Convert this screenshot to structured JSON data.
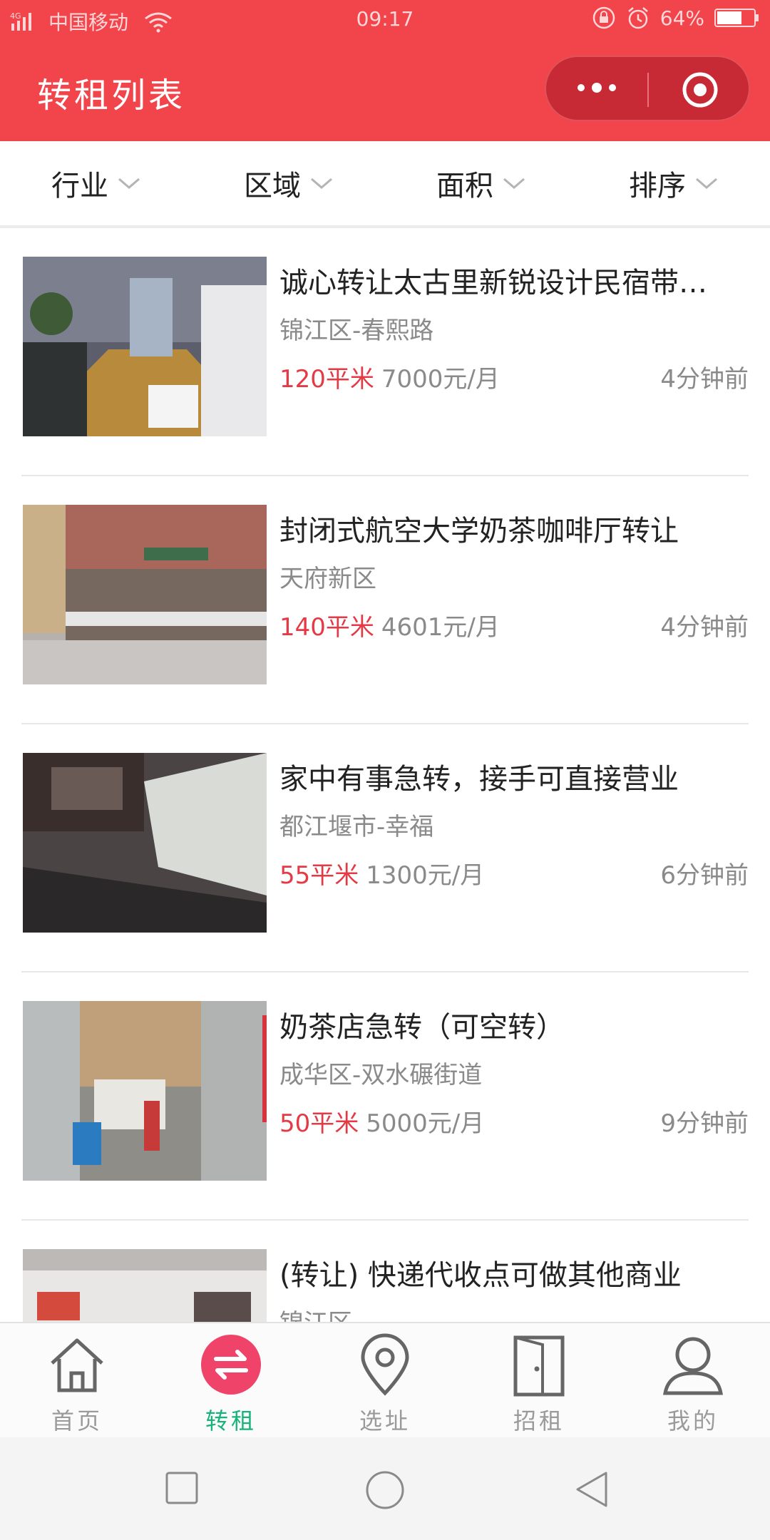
{
  "status_bar": {
    "network": "4G",
    "carrier": "中国移动",
    "time": "09:17",
    "battery": "64%",
    "icons": [
      "signal-icon",
      "wifi-icon",
      "lock-rotation-icon",
      "alarm-icon",
      "battery-icon"
    ]
  },
  "header": {
    "title": "转租列表",
    "buttons": [
      "more-icon",
      "close-icon"
    ],
    "background": "#f2444b"
  },
  "filters": [
    {
      "label": "行业",
      "icon": "chevron-down-icon"
    },
    {
      "label": "区域",
      "icon": "chevron-down-icon"
    },
    {
      "label": "面积",
      "icon": "chevron-down-icon"
    },
    {
      "label": "排序",
      "icon": "chevron-down-icon"
    }
  ],
  "listings": [
    {
      "title": "诚心转让太古里新锐设计民宿带…",
      "location": "锦江区-春熙路",
      "area": "120平米",
      "rent": "7000元/月",
      "time": "4分钟前"
    },
    {
      "title": "封闭式航空大学奶茶咖啡厅转让",
      "location": "天府新区",
      "area": "140平米",
      "rent": "4601元/月",
      "time": "4分钟前"
    },
    {
      "title": "家中有事急转，接手可直接营业",
      "location": "都江堰市-幸福",
      "area": "55平米",
      "rent": "1300元/月",
      "time": "6分钟前"
    },
    {
      "title": "奶茶店急转（可空转）",
      "location": "成华区-双水碾街道",
      "area": "50平米",
      "rent": "5000元/月",
      "time": "9分钟前"
    },
    {
      "title": "(转让) 快递代收点可做其他商业",
      "location": "锦江区",
      "area": "",
      "rent": "",
      "time": ""
    }
  ],
  "tabs": [
    {
      "label": "首页",
      "icon": "home-icon",
      "active": false
    },
    {
      "label": "转租",
      "icon": "transfer-icon",
      "active": true
    },
    {
      "label": "选址",
      "icon": "location-pin-icon",
      "active": false
    },
    {
      "label": "招租",
      "icon": "door-icon",
      "active": false
    },
    {
      "label": "我的",
      "icon": "user-icon",
      "active": false
    }
  ],
  "colors": {
    "brand": "#f2444b",
    "price": "#e53a45",
    "active_tab": "#17b37a",
    "transfer_badge": "#f0436a"
  }
}
